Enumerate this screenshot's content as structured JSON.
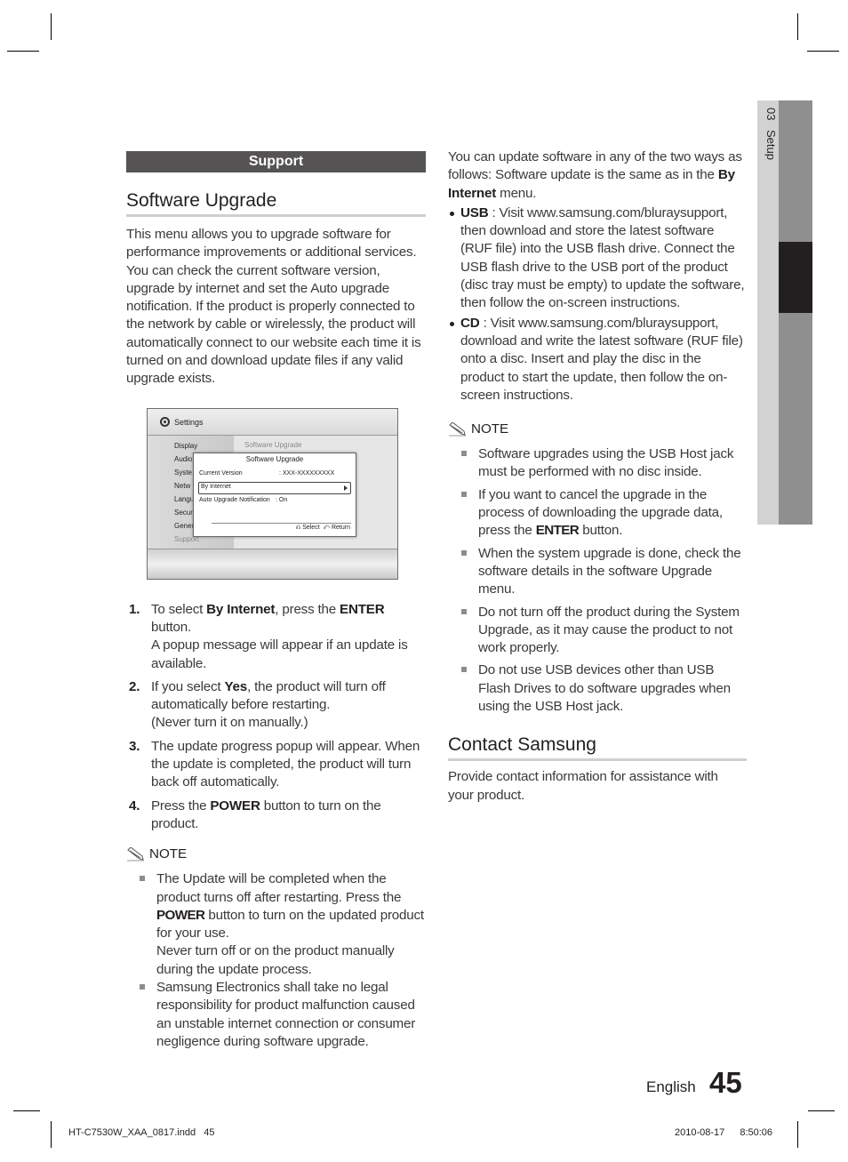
{
  "side_tab": {
    "chapter_number": "03",
    "chapter_title": "Setup"
  },
  "left": {
    "section_bar": "Support",
    "heading": "Software Upgrade",
    "intro": "This menu allows you to upgrade software for performance improvements or additional services. You can check the current software version, upgrade by internet and set the Auto upgrade notification. If the product is properly connected to the network by cable or wirelessly, the product will automatically connect to our website each time it is turned on and download update files if any valid upgrade exists.",
    "screen": {
      "title": "Settings",
      "menu_items": [
        "Display",
        "Audio",
        "Syste",
        "Netw",
        "Langu",
        "Secur",
        "Gener",
        "Support"
      ],
      "right_pane_title": "Software Upgrade",
      "popup": {
        "title": "Software Upgrade",
        "current_version_label": "Current Version",
        "current_version_value": ": XXX-XXXXXXXXX",
        "by_internet": "By Internet",
        "auto_label": "Auto Upgrade Notification",
        "auto_value": ": On",
        "select_key": "Select",
        "return_key": "Return"
      }
    },
    "steps": [
      {
        "num": "1.",
        "pre": "To select ",
        "b1": "By Internet",
        "mid": ", press the ",
        "b2": "ENTER",
        "post": " button.",
        "extra": "A popup message will appear if an update is available."
      },
      {
        "num": "2.",
        "pre": "If you select ",
        "b1": "Yes",
        "mid": ", the product will turn off automatically before restarting.",
        "extra": "(Never turn it on manually.)"
      },
      {
        "num": "3.",
        "text": "The update progress popup will appear. When the update is completed, the product will turn back off automatically."
      },
      {
        "num": "4.",
        "pre": "Press the ",
        "b1": "POWER",
        "post": " button to turn on the product."
      }
    ],
    "note_label": "NOTE",
    "notes": [
      {
        "pre": "The Update will be completed when the product turns off after restarting. Press the ",
        "bold": "POWER",
        "post": " button to turn on the updated product for your use.",
        "extra": "Never turn off or on the product manually during the update process."
      },
      {
        "text": "Samsung Electronics shall take no legal responsibility for product malfunction caused an unstable internet connection or consumer negligence during software upgrade."
      }
    ]
  },
  "right": {
    "intro_pre": "You can update software in any of the two ways as follows: Software update is the same as in the ",
    "intro_bold": "By Internet",
    "intro_post": " menu.",
    "bullets": [
      {
        "label": "USB",
        "text": " : Visit www.samsung.com/bluraysupport, then download and store the latest software (RUF file) into the USB flash drive. Connect the USB flash drive to the USB port of the product (disc tray must be empty) to update the software, then follow the on-screen instructions."
      },
      {
        "label": "CD",
        "text": " : Visit www.samsung.com/bluraysupport, download and write the latest software (RUF file) onto a disc. Insert and play the disc in the product to start the update, then follow the on-screen instructions."
      }
    ],
    "note_label": "NOTE",
    "notes": [
      {
        "text": "Software upgrades using the USB Host jack must be performed with no disc inside."
      },
      {
        "pre": "If you want to cancel the upgrade in the process of downloading the upgrade data, press the ",
        "bold": "ENTER",
        "post": " button."
      },
      {
        "text": "When the system upgrade is done, check the software details in the software Upgrade menu."
      },
      {
        "text": "Do not turn off the product during the System Upgrade, as it may cause the product to not work properly."
      },
      {
        "text": "Do not use USB devices other than USB Flash Drives to do software upgrades when using the USB Host jack."
      }
    ],
    "contact_heading": "Contact Samsung",
    "contact_text": "Provide contact information for assistance with your product."
  },
  "footer": {
    "language": "English",
    "page_number": "45",
    "slug_file": "HT-C7530W_XAA_0817.indd   45",
    "slug_date": "2010-08-17",
    "slug_time": "8:50:06"
  }
}
